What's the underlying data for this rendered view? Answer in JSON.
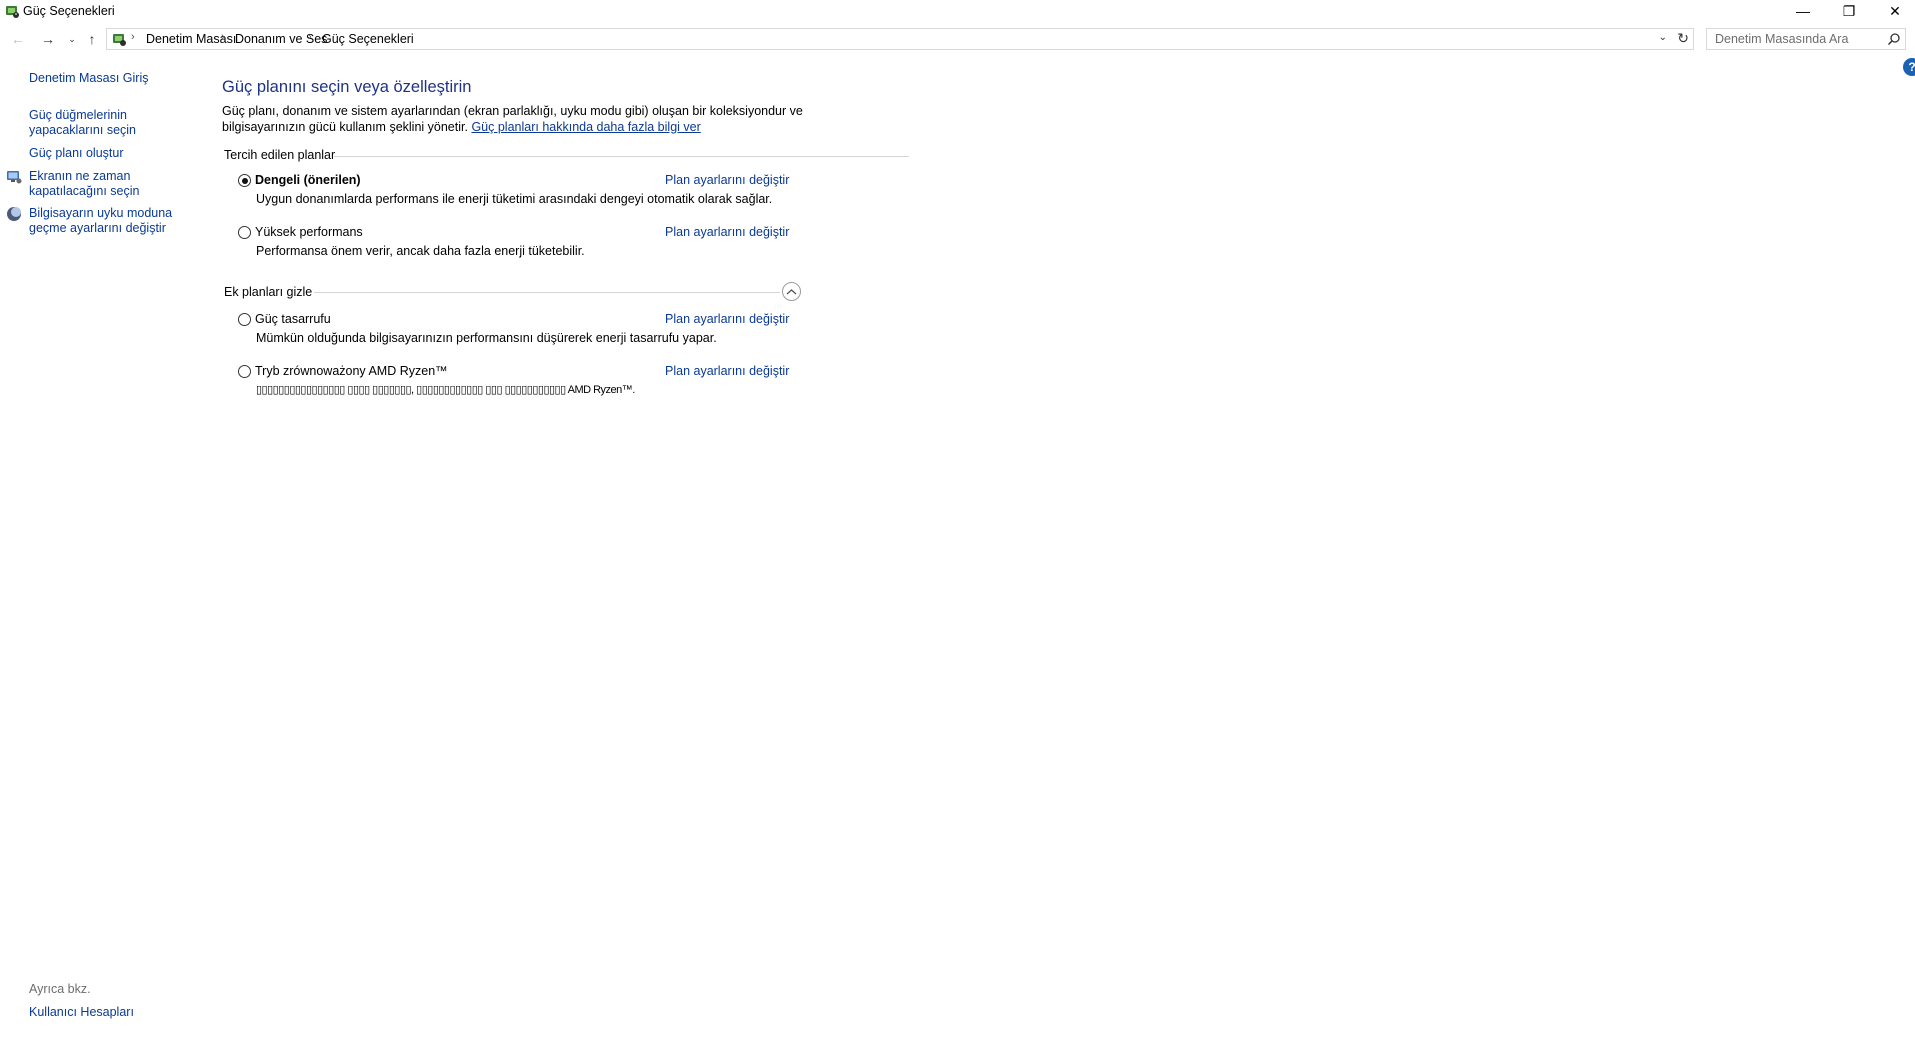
{
  "window": {
    "title": "Güç Seçenekleri",
    "minimize_glyph": "—",
    "maximize_glyph": "❐",
    "close_glyph": "✕"
  },
  "nav": {
    "back_glyph": "←",
    "forward_glyph": "→",
    "recent_glyph": "⌄",
    "up_glyph": "↑",
    "breadcrumbs": [
      "Denetim Masası",
      "Donanım ve Ses",
      "Güç Seçenekleri"
    ],
    "separator": "›",
    "dropdown_glyph": "⌄",
    "refresh_glyph": "↻",
    "search_placeholder": "Denetim Masasında Ara"
  },
  "help": {
    "glyph": "?"
  },
  "sidebar": {
    "home": "Denetim Masası Giriş",
    "items": [
      {
        "label_line1": "Güç düğmelerinin",
        "label_line2": "yapacaklarını seçin",
        "icon": "none"
      },
      {
        "label_line1": "Güç planı oluştur",
        "label_line2": "",
        "icon": "none"
      },
      {
        "label_line1": "Ekranın ne zaman",
        "label_line2": "kapatılacağını seçin",
        "icon": "monitor-icon"
      },
      {
        "label_line1": "Bilgisayarın uyku moduna",
        "label_line2": "geçme ayarlarını değiştir",
        "icon": "moon-icon"
      }
    ],
    "see_also": "Ayrıca bkz.",
    "bottom_link": "Kullanıcı Hesapları"
  },
  "main": {
    "title": "Güç planını seçin veya özelleştirin",
    "description_line1": "Güç planı, donanım ve sistem ayarlarından (ekran parlaklığı, uyku modu gibi) oluşan bir koleksiyondur ve",
    "description_line2": "bilgisayarınızın gücü kullanım şeklini yönetir.",
    "learn_more_link": "Güç planları hakkında daha fazla bilgi ver",
    "preferred_header": "Tercih edilen planlar",
    "additional_header": "Ek planları gizle",
    "change_link": "Plan ayarlarını değiştir",
    "preferred_plans": [
      {
        "name": "Dengeli (önerilen)",
        "description": "Uygun donanımlarda performans ile enerji tüketimi arasındaki dengeyi otomatik olarak sağlar.",
        "selected": true
      },
      {
        "name": "Yüksek performans",
        "description": "Performansa önem verir, ancak daha fazla enerji tüketebilir.",
        "selected": false
      }
    ],
    "additional_plans": [
      {
        "name": "Güç tasarrufu",
        "description": "Mümkün olduğunda bilgisayarınızın performansını düşürerek enerji tasarrufu yapar.",
        "selected": false
      },
      {
        "name": "Tryb zrównoważony AMD Ryzen™",
        "description": "▯▯▯▯▯▯▯▯▯▯▯▯▯▯▯▯ ▯▯▯▯ ▯▯▯▯▯▯▯, ▯▯▯▯▯▯▯▯▯▯▯▯ ▯▯▯ ▯▯▯▯▯▯▯▯▯▯▯ AMD Ryzen™.",
        "selected": false
      }
    ]
  }
}
